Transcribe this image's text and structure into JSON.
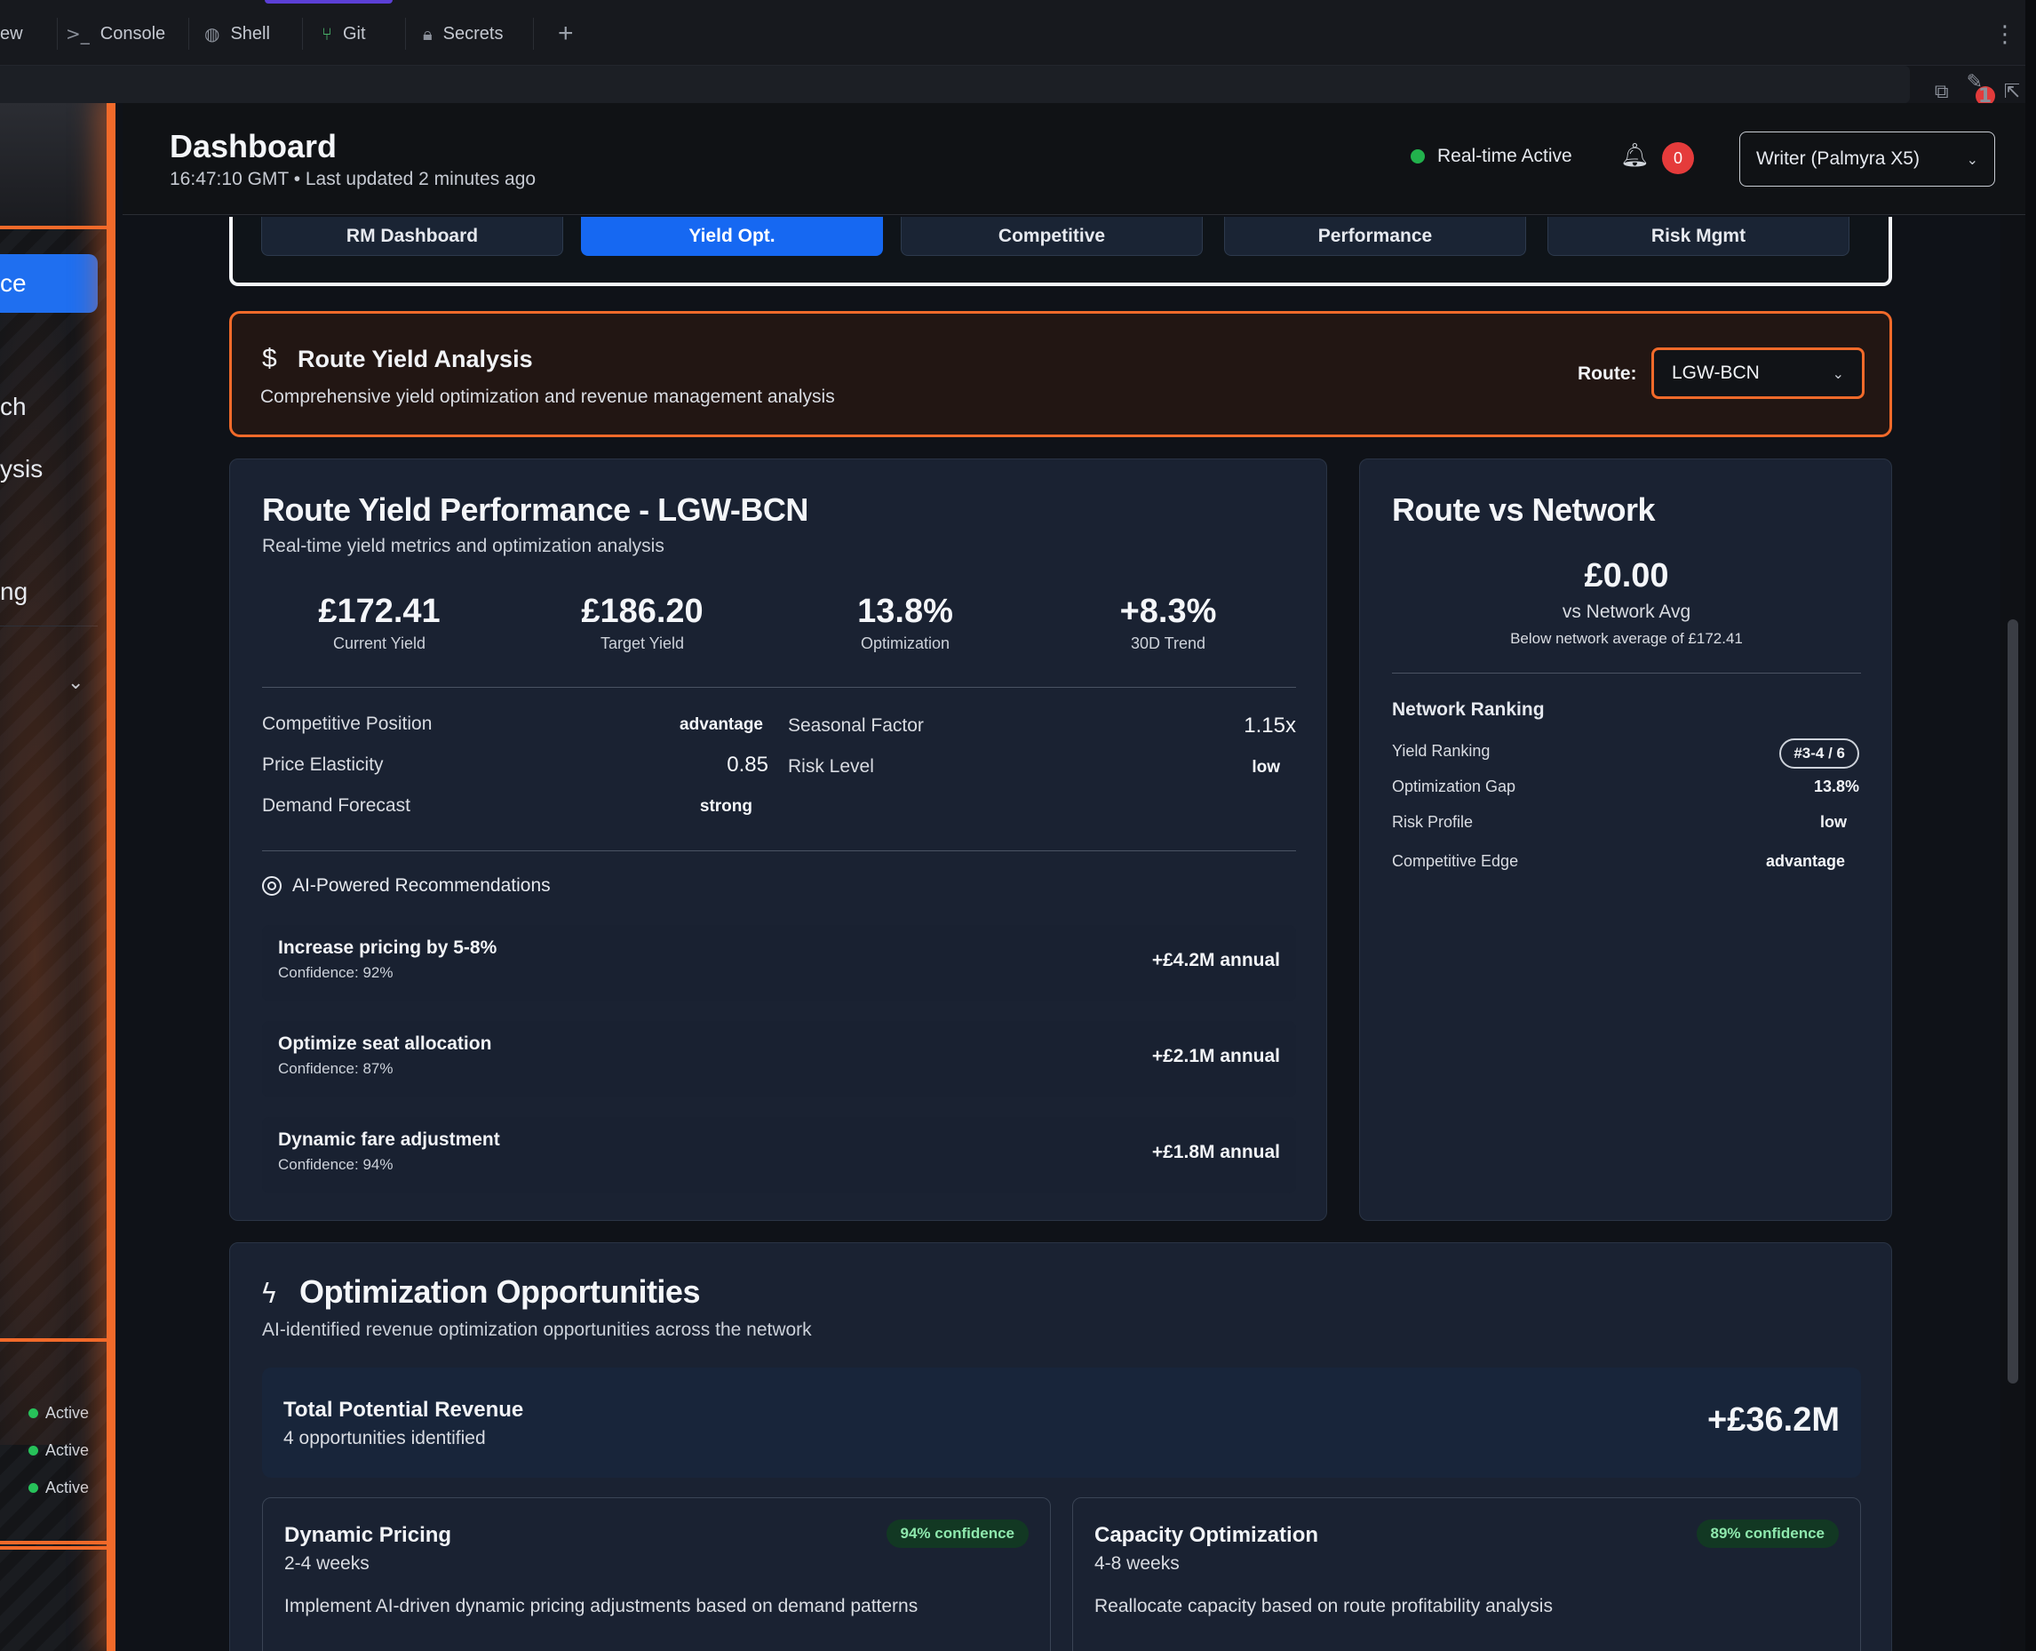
{
  "browser": {
    "tabs": [
      {
        "label": "ew",
        "icon": "partial"
      },
      {
        "label": "Console",
        "icon": ">_"
      },
      {
        "label": "Shell",
        "icon": "shell-icon"
      },
      {
        "label": "Git",
        "icon": "git-icon"
      },
      {
        "label": "Secrets",
        "icon": "lock-icon"
      }
    ],
    "add_tab": "+",
    "more": "⋮",
    "notification_count": "1"
  },
  "sidebar": {
    "active_item": "ce",
    "items": [
      "ch",
      "ysis",
      "ng"
    ],
    "statuses": [
      "Active",
      "Active",
      "Active"
    ]
  },
  "header": {
    "title": "Dashboard",
    "subtitle": "16:47:10 GMT • Last updated 2 minutes ago",
    "realtime": "Real-time Active",
    "notif_count": "0",
    "model": "Writer (Palmyra X5)"
  },
  "nav_tabs": [
    "RM Dashboard",
    "Yield Opt.",
    "Competitive",
    "Performance",
    "Risk Mgmt"
  ],
  "nav_active": "Yield Opt.",
  "banner": {
    "icon": "$",
    "title": "Route Yield Analysis",
    "subtitle": "Comprehensive yield optimization and revenue management analysis",
    "route_label": "Route:",
    "route_value": "LGW-BCN"
  },
  "performance": {
    "title": "Route Yield Performance - LGW-BCN",
    "subtitle": "Real-time yield metrics and optimization analysis",
    "metrics": [
      {
        "value": "£172.41",
        "label": "Current Yield"
      },
      {
        "value": "£186.20",
        "label": "Target Yield"
      },
      {
        "value": "13.8%",
        "label": "Optimization"
      },
      {
        "value": "+8.3%",
        "label": "30D Trend"
      }
    ],
    "details": [
      {
        "key": "Competitive Position",
        "value": "advantage"
      },
      {
        "key": "Price Elasticity",
        "value": "0.85"
      },
      {
        "key": "Demand Forecast",
        "value": "strong"
      },
      {
        "key": "Seasonal Factor",
        "value": "1.15x"
      },
      {
        "key": "Risk Level",
        "value": "low"
      }
    ],
    "ai_heading": "AI-Powered Recommendations",
    "recommendations": [
      {
        "title": "Increase pricing by 5-8%",
        "confidence": "Confidence: 92%",
        "impact": "+£4.2M annual"
      },
      {
        "title": "Optimize seat allocation",
        "confidence": "Confidence: 87%",
        "impact": "+£2.1M annual"
      },
      {
        "title": "Dynamic fare adjustment",
        "confidence": "Confidence: 94%",
        "impact": "+£1.8M annual"
      }
    ]
  },
  "network": {
    "title": "Route vs Network",
    "value": "£0.00",
    "vs": "vs Network Avg",
    "below": "Below network average of £172.41",
    "ranking_title": "Network Ranking",
    "rows": [
      {
        "key": "Yield Ranking",
        "value": "#3-4 / 6"
      },
      {
        "key": "Optimization Gap",
        "value": "13.8%"
      },
      {
        "key": "Risk Profile",
        "value": "low"
      },
      {
        "key": "Competitive Edge",
        "value": "advantage"
      }
    ]
  },
  "opportunities": {
    "title": "Optimization Opportunities",
    "subtitle": "AI-identified revenue optimization opportunities across the network",
    "total_title": "Total Potential Revenue",
    "total_sub": "4 opportunities identified",
    "total_value": "+£36.2M",
    "cards": [
      {
        "title": "Dynamic Pricing",
        "duration": "2-4 weeks",
        "desc": "Implement AI-driven dynamic pricing adjustments based on demand patterns",
        "confidence": "94% confidence"
      },
      {
        "title": "Capacity Optimization",
        "duration": "4-8 weeks",
        "desc": "Reallocate capacity based on route profitability analysis",
        "confidence": "89% confidence"
      }
    ]
  },
  "colors": {
    "accent_orange": "#f26a2a",
    "active_blue": "#1668f2",
    "status_green": "#22b14c"
  }
}
